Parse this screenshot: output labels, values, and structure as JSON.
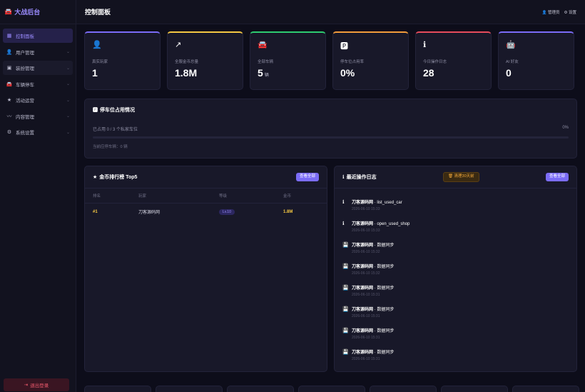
{
  "brand": "大战后台",
  "sidebar": {
    "items": [
      {
        "label": "控制面板",
        "icon": "grid-icon",
        "glyph": "▦"
      },
      {
        "label": "用户管理",
        "icon": "user-icon",
        "glyph": "👤"
      },
      {
        "label": "装扮管理",
        "icon": "box-icon",
        "glyph": "▣"
      },
      {
        "label": "车辆停车",
        "icon": "car-icon",
        "glyph": "🚘"
      },
      {
        "label": "活动运营",
        "icon": "star-icon",
        "glyph": "★"
      },
      {
        "label": "内容管理",
        "icon": "chart-icon",
        "glyph": "〰"
      },
      {
        "label": "系统设置",
        "icon": "gear-icon",
        "glyph": "⚙"
      }
    ],
    "logout": "退出登录"
  },
  "header": {
    "title": "控制面板",
    "user": "管理员",
    "settings": "设置"
  },
  "cards": [
    {
      "label": "真实玩家",
      "value": "1",
      "unit": "",
      "color": "#7b6cf6",
      "glyph": "👤"
    },
    {
      "label": "全服金币总量",
      "value": "1.8M",
      "unit": "",
      "color": "#f5c842",
      "glyph": "↗"
    },
    {
      "label": "全部车辆",
      "value": "5",
      "unit": "辆",
      "color": "#2ecc71",
      "glyph": "🚘"
    },
    {
      "label": "停车位占用率",
      "value": "0%",
      "unit": "",
      "color": "#f39c3b",
      "glyph": "🅿"
    },
    {
      "label": "今日操作日志",
      "value": "28",
      "unit": "",
      "color": "#e74c5c",
      "glyph": "ℹ"
    },
    {
      "label": "AI 好友",
      "value": "0",
      "unit": "",
      "color": "#7b6cf6",
      "glyph": "🤖"
    }
  ],
  "parking": {
    "title": "停车位占用情况",
    "occupied_text": "已占用 0 / 3 个私家车位",
    "percent": "0%",
    "fill_fraction": 0,
    "current": "当前应停车辆：0 辆"
  },
  "ranking": {
    "title": "金币排行榜 Top5",
    "view_all": "查看全部",
    "columns": [
      "排名",
      "玩家",
      "等级",
      "金币"
    ],
    "rows": [
      {
        "rank": "#1",
        "player": "刀客源码网",
        "level": "Lv.10",
        "coins": "1.8M"
      }
    ]
  },
  "logs": {
    "title": "最近操作日志",
    "clear": "清理30天前",
    "view_all": "查看全部",
    "items": [
      {
        "user": "刀客源码网",
        "action": " · list_used_car",
        "time": "2026-06-10 15:33",
        "glyph": "ℹ"
      },
      {
        "user": "刀客源码网",
        "action": " · open_used_shop",
        "time": "2026-06-10 15:33",
        "glyph": "ℹ"
      },
      {
        "user": "刀客源码网",
        "action": " · 数据同步",
        "time": "2026-06-10 15:32",
        "glyph": "💾"
      },
      {
        "user": "刀客源码网",
        "action": " · 数据同步",
        "time": "2026-06-10 15:32",
        "glyph": "💾"
      },
      {
        "user": "刀客源码网",
        "action": " · 数据同步",
        "time": "2026-06-10 15:31",
        "glyph": "💾"
      },
      {
        "user": "刀客源码网",
        "action": " · 数据同步",
        "time": "2026-06-10 15:31",
        "glyph": "💾"
      },
      {
        "user": "刀客源码网",
        "action": " · 数据同步",
        "time": "2026-06-10 15:31",
        "glyph": "💾"
      },
      {
        "user": "刀客源码网",
        "action": " · 数据同步",
        "time": "2026-06-10 15:31",
        "glyph": "💾"
      }
    ]
  }
}
